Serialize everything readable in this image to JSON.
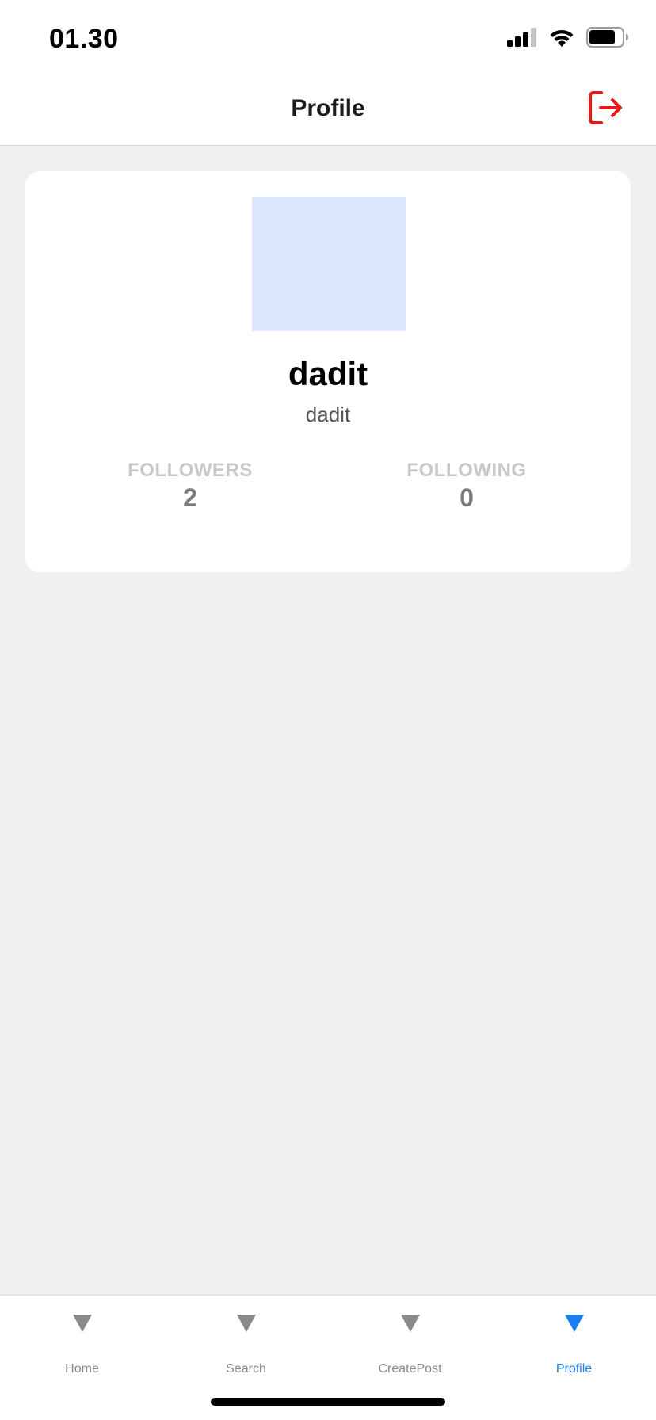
{
  "status_bar": {
    "time": "01.30",
    "icons": [
      "cellular-signal-icon",
      "wifi-icon",
      "battery-icon"
    ]
  },
  "header": {
    "title": "Profile",
    "logout_icon": "logout-icon",
    "logout_color": "#e31b1b"
  },
  "profile": {
    "display_name": "dadit",
    "username": "dadit",
    "avatar_color": "#d9e6fb",
    "followers_label": "FOLLOWERS",
    "followers_count": "2",
    "following_label": "FOLLOWING",
    "following_count": "0"
  },
  "tab_bar": {
    "active_color": "#1a7ff0",
    "inactive_color": "#8a8a8a",
    "tabs": [
      {
        "label": "Home",
        "active": false
      },
      {
        "label": "Search",
        "active": false
      },
      {
        "label": "CreatePost",
        "active": false
      },
      {
        "label": "Profile",
        "active": true
      }
    ]
  }
}
